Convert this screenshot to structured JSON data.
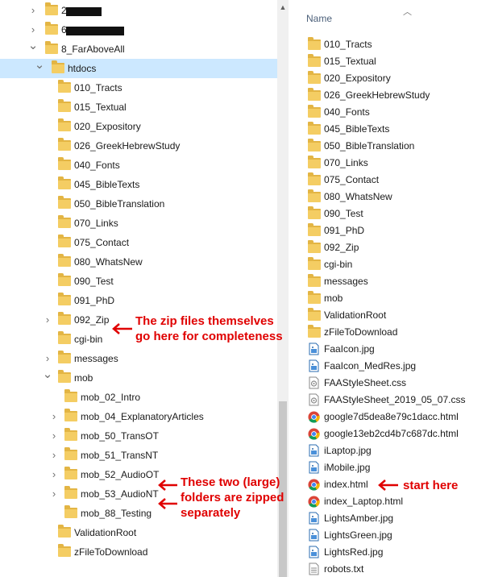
{
  "tree": {
    "items": [
      {
        "label": "2",
        "redacted": true
      },
      {
        "label": "6",
        "redacted": true
      },
      {
        "label": "8_FarAboveAll"
      },
      {
        "label": "htdocs"
      },
      {
        "label": "010_Tracts"
      },
      {
        "label": "015_Textual"
      },
      {
        "label": "020_Expository"
      },
      {
        "label": "026_GreekHebrewStudy"
      },
      {
        "label": "040_Fonts"
      },
      {
        "label": "045_BibleTexts"
      },
      {
        "label": "050_BibleTranslation"
      },
      {
        "label": "070_Links"
      },
      {
        "label": "075_Contact"
      },
      {
        "label": "080_WhatsNew"
      },
      {
        "label": "090_Test"
      },
      {
        "label": "091_PhD"
      },
      {
        "label": "092_Zip"
      },
      {
        "label": "cgi-bin"
      },
      {
        "label": "messages"
      },
      {
        "label": "mob"
      },
      {
        "label": "mob_02_Intro"
      },
      {
        "label": "mob_04_ExplanatoryArticles"
      },
      {
        "label": "mob_50_TransOT"
      },
      {
        "label": "mob_51_TransNT"
      },
      {
        "label": "mob_52_AudioOT"
      },
      {
        "label": "mob_53_AudioNT"
      },
      {
        "label": "mob_88_Testing"
      },
      {
        "label": "ValidationRoot"
      },
      {
        "label": "zFileToDownload"
      }
    ]
  },
  "list": {
    "header": "Name",
    "items": [
      {
        "label": "010_Tracts",
        "icon": "folder-icon"
      },
      {
        "label": "015_Textual",
        "icon": "folder-icon"
      },
      {
        "label": "020_Expository",
        "icon": "folder-icon"
      },
      {
        "label": "026_GreekHebrewStudy",
        "icon": "folder-icon"
      },
      {
        "label": "040_Fonts",
        "icon": "folder-icon"
      },
      {
        "label": "045_BibleTexts",
        "icon": "folder-icon"
      },
      {
        "label": "050_BibleTranslation",
        "icon": "folder-icon"
      },
      {
        "label": "070_Links",
        "icon": "folder-icon"
      },
      {
        "label": "075_Contact",
        "icon": "folder-icon"
      },
      {
        "label": "080_WhatsNew",
        "icon": "folder-icon"
      },
      {
        "label": "090_Test",
        "icon": "folder-icon"
      },
      {
        "label": "091_PhD",
        "icon": "folder-icon"
      },
      {
        "label": "092_Zip",
        "icon": "folder-icon"
      },
      {
        "label": "cgi-bin",
        "icon": "folder-icon"
      },
      {
        "label": "messages",
        "icon": "folder-icon"
      },
      {
        "label": "mob",
        "icon": "folder-icon"
      },
      {
        "label": "ValidationRoot",
        "icon": "folder-icon"
      },
      {
        "label": "zFileToDownload",
        "icon": "folder-icon"
      },
      {
        "label": "FaaIcon.jpg",
        "icon": "image-file-icon"
      },
      {
        "label": "FaaIcon_MedRes.jpg",
        "icon": "image-file-icon"
      },
      {
        "label": "FAAStyleSheet.css",
        "icon": "css-file-icon"
      },
      {
        "label": "FAAStyleSheet_2019_05_07.css",
        "icon": "css-file-icon"
      },
      {
        "label": "google7d5dea8e79c1dacc.html",
        "icon": "chrome-html-icon"
      },
      {
        "label": "google13eb2cd4b7c687dc.html",
        "icon": "chrome-html-icon"
      },
      {
        "label": "iLaptop.jpg",
        "icon": "image-file-icon"
      },
      {
        "label": "iMobile.jpg",
        "icon": "image-file-icon"
      },
      {
        "label": "index.html",
        "icon": "chrome-html-icon"
      },
      {
        "label": "index_Laptop.html",
        "icon": "chrome-html-icon"
      },
      {
        "label": "LightsAmber.jpg",
        "icon": "image-file-icon"
      },
      {
        "label": "LightsGreen.jpg",
        "icon": "image-file-icon"
      },
      {
        "label": "LightsRed.jpg",
        "icon": "image-file-icon"
      },
      {
        "label": "robots.txt",
        "icon": "text-file-icon"
      }
    ]
  },
  "annotations": {
    "zip_line1": "The zip files themselves",
    "zip_line2": "go here for completeness",
    "audio_line1": "These two (large)",
    "audio_line2": "folders are zipped",
    "audio_line3": "separately",
    "start": "start here"
  },
  "colors": {
    "folder": "#f4cd63",
    "selection": "#cce8ff",
    "annotation": "#e00000",
    "header_text": "#4c607a"
  }
}
